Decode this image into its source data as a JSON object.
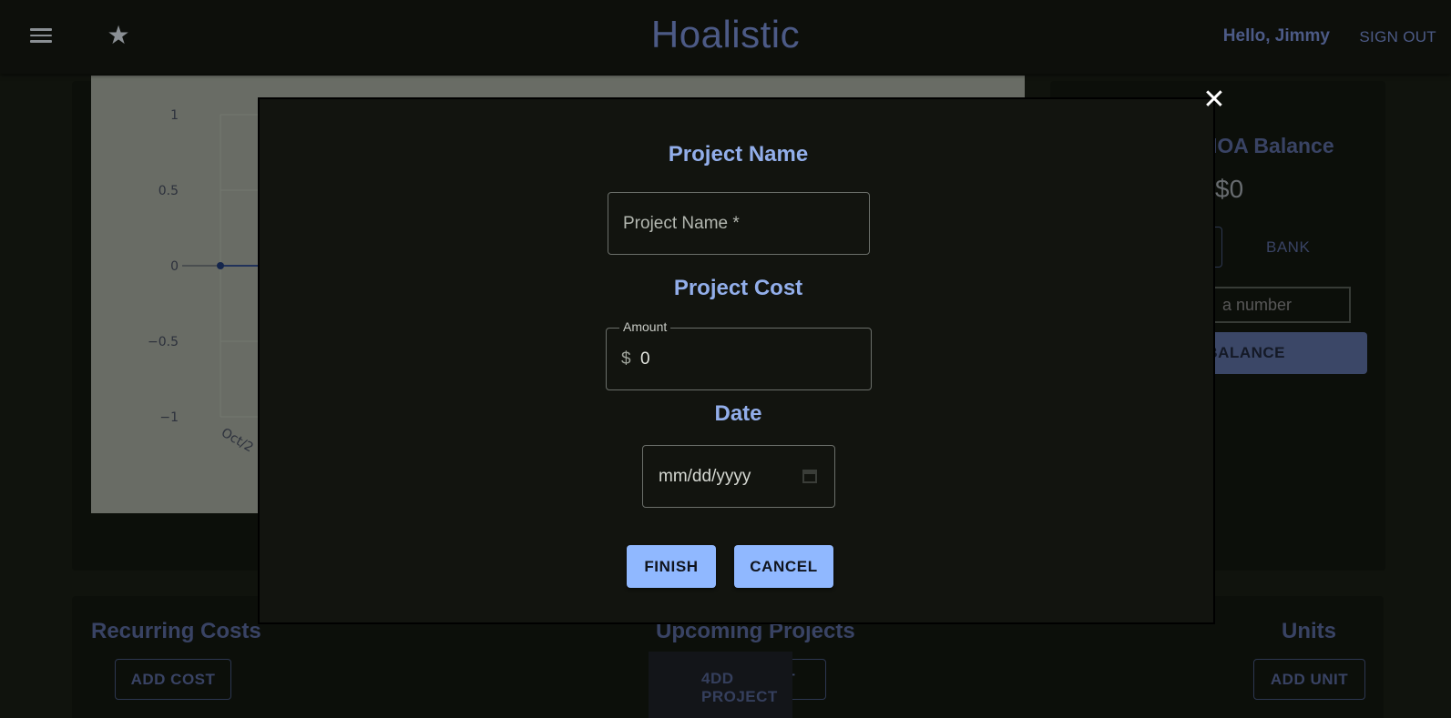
{
  "header": {
    "menu_icon": "hamburger-icon",
    "favorite_icon": "star-icon",
    "title": "Hoalistic",
    "greeting": "Hello, Jimmy",
    "signout_label": "SIGN OUT"
  },
  "colors": {
    "accent": "#4c5a86",
    "modal_label": "#92aeea",
    "modal_button": "#90b8ff",
    "modal_background": "#12140f",
    "page_background": "#161a12"
  },
  "chart_data": {
    "type": "line",
    "title": "",
    "xlabel": "",
    "ylabel": "",
    "x": [
      "Oct/2"
    ],
    "series": [
      {
        "values": [
          0
        ]
      }
    ],
    "yticks": [
      "1",
      "0.5",
      "0",
      "−0.5",
      "−1"
    ],
    "xticks": [
      "Oct/2"
    ],
    "ylim": [
      -1,
      1
    ],
    "grid": true
  },
  "balance": {
    "title": "IOA Balance",
    "value": "$0",
    "bank_label": "BANK",
    "input_placeholder": "a number",
    "update_label": "E BALANCE"
  },
  "sections": {
    "recurring_title": "Recurring Costs",
    "add_cost_label": "ADD COST",
    "projects_title": "Upcoming Projects",
    "add_project_label": "ADD PROJECT",
    "glitch_text": "4DD PROJECT",
    "units_title": "Units",
    "add_unit_label": "ADD UNIT"
  },
  "modal": {
    "close_icon": "close-icon",
    "name_label": "Project Name",
    "name_placeholder": "Project Name *",
    "cost_label": "Project Cost",
    "amount_legend": "Amount",
    "currency_symbol": "$",
    "amount_value": "0",
    "date_label": "Date",
    "date_placeholder": "mm/dd/yyyy",
    "calendar_icon": "calendar-icon",
    "finish_label": "FINISH",
    "cancel_label": "CANCEL"
  }
}
